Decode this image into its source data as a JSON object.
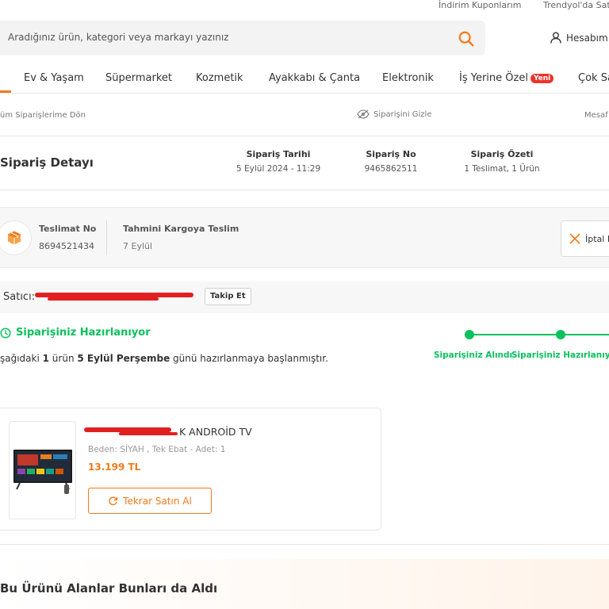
{
  "top_links": [
    "İndirim Kuponlarım",
    "Trendyol'da Sat"
  ],
  "search": {
    "placeholder": "Aradığınız ürün, kategori veya markayı yazınız",
    "icon": "search-icon"
  },
  "account": {
    "label": "Hesabım",
    "icon": "user-icon"
  },
  "nav": {
    "items": [
      "Ev & Yaşam",
      "Süpermarket",
      "Kozmetik",
      "Ayakkabı & Çanta",
      "Elektronik",
      "İş Yerine Özel",
      "Çok Sa"
    ],
    "new_badge": "Yeni"
  },
  "order_actions": {
    "back": "üm Siparişlerime Dön",
    "hide": "Siparişini Gizle",
    "mesafe": "Mesaf"
  },
  "order_detail": {
    "title": "Sipariş Detayı",
    "date_label": "Sipariş Tarihi",
    "date_value": "5 Eylül 2024 - 11:29",
    "no_label": "Sipariş No",
    "no_value": "9465862511",
    "summary_label": "Sipariş Özeti",
    "summary_value": "1 Teslimat, 1 Ürün"
  },
  "delivery": {
    "no_label": "Teslimat No",
    "no_value": "8694521434",
    "eta_label": "Tahmini Kargoya Teslim",
    "eta_value": "7 Eylül",
    "cancel_label": "İptal E"
  },
  "seller": {
    "label": "Satıcı:",
    "follow": "Takip Et"
  },
  "status": {
    "title": "Siparişiniz Hazırlanıyor",
    "desc_pre": "şağıdaki ",
    "desc_count": "1",
    "desc_mid": " ürün ",
    "desc_date": "5 Eylül Perşembe",
    "desc_post": " günü hazırlanmaya başlanmıştır.",
    "steps": [
      "Siparişiniz Alındı",
      "Siparişiniz Hazırlanıyor"
    ]
  },
  "product": {
    "name": "K ANDROİD TV",
    "attributes": "Beden: SİYAH , Tek Ebat - Adet: 1",
    "price": "13.199 TL",
    "rebuy": "Tekrar Satın Al"
  },
  "recommend": {
    "title": "Bu Ürünü Alanlar Bunları da Aldı"
  },
  "colors": {
    "brand": "#f27a1a",
    "success": "#0bc15c",
    "badge": "#e8362b",
    "redaction": "#e02020"
  }
}
